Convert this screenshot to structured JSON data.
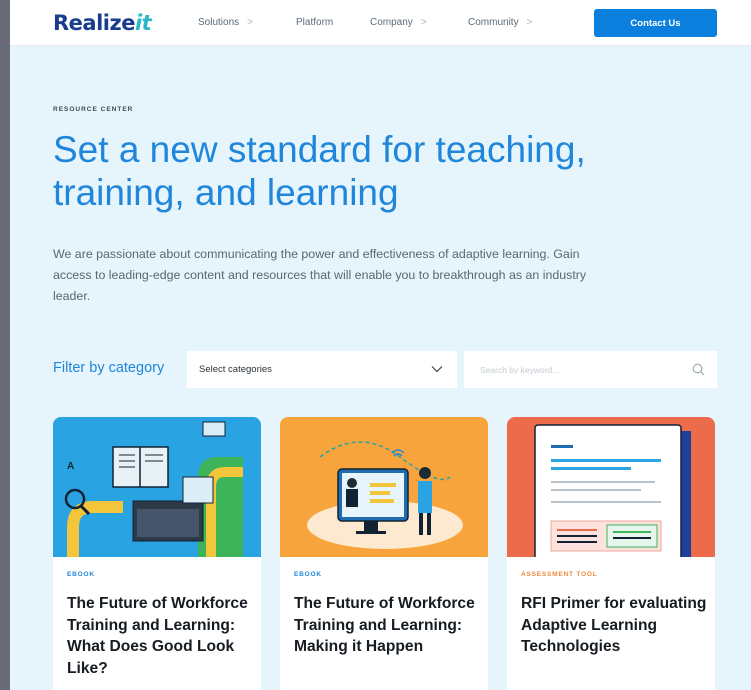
{
  "header": {
    "logo_main": "Realize",
    "logo_accent": "it",
    "nav": [
      {
        "label": "Solutions",
        "chevron": ">"
      },
      {
        "label": "Platform",
        "chevron": ""
      },
      {
        "label": "Company",
        "chevron": ">"
      },
      {
        "label": "Community",
        "chevron": ">"
      }
    ],
    "contact_label": "Contact Us"
  },
  "hero": {
    "eyebrow": "RESOURCE CENTER",
    "title": "Set a new standard for teaching, training, and learning",
    "text": "We are passionate about communicating the power and effectiveness of adaptive learning. Gain access to leading-edge content and resources that will enable you to breakthrough as an industry leader."
  },
  "filter": {
    "label": "Filter by category",
    "select_value": "Select categories",
    "search_placeholder": "Search by keyword..."
  },
  "cards": [
    {
      "tag": "EBOOK",
      "title": "The Future of Workforce Training and Learning: What Does Good Look Like?",
      "tag_color": "#1f86dc"
    },
    {
      "tag": "EBOOK",
      "title": "The Future of Workforce Training and Learning: Making it Happen",
      "tag_color": "#1f86dc"
    },
    {
      "tag": "ASSESSMENT TOOL",
      "title": "RFI Primer for evaluating Adaptive Learning Technologies",
      "tag_color": "#f0883a"
    }
  ],
  "colors": {
    "accent": "#1f86dc",
    "button": "#0b7fde",
    "background": "#e5f5fb"
  }
}
